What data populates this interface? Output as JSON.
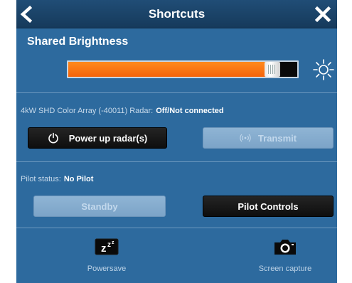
{
  "dialog": {
    "title": "Shortcuts"
  },
  "brightness": {
    "section_title": "Shared Brightness",
    "level_fraction": 0.89
  },
  "radar": {
    "label": "4kW SHD Color Array (-40011) Radar:",
    "status": "Off/Not connected",
    "power_button": "Power up radar(s)",
    "transmit_button": "Transmit"
  },
  "pilot": {
    "label": "Pilot status:",
    "status": "No Pilot",
    "standby_button": "Standby",
    "controls_button": "Pilot Controls"
  },
  "bottom": {
    "powersave_label": "Powersave",
    "screen_capture_label": "Screen capture"
  },
  "icons": {
    "back": "back-arrow-icon",
    "close": "close-icon",
    "moon": "moon-icon",
    "sun": "sun-icon",
    "power": "power-icon",
    "transmit": "wireless-icon",
    "powersave": "sleep-zzz-icon",
    "camera": "camera-icon"
  },
  "colors": {
    "panel": "#2d6a9e",
    "titlebar": "#1b4368",
    "accent_orange": "#f5640a",
    "button_dark": "#111111",
    "button_disabled": "#84aacc"
  }
}
